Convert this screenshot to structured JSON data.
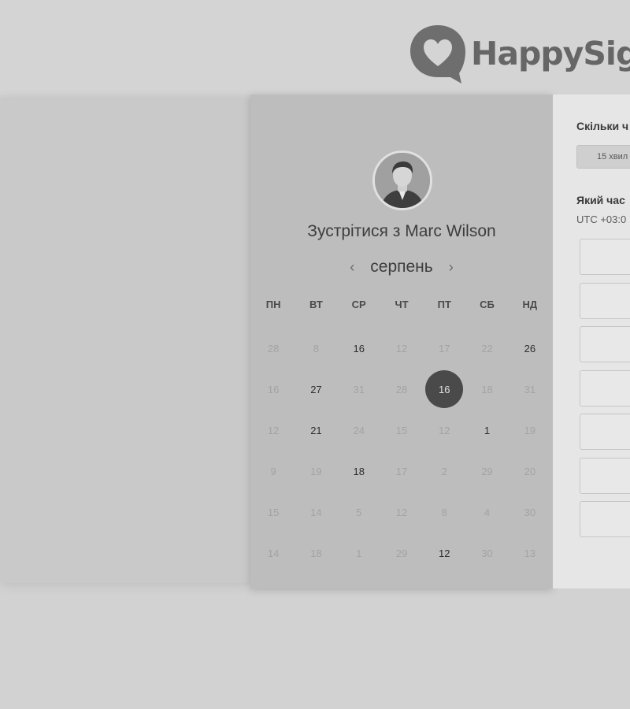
{
  "brand": {
    "name": "HappySig"
  },
  "scheduler": {
    "meet_with": "Зустрітися з Marc Wilson",
    "month": "серпень",
    "prev_arrow": "‹",
    "next_arrow": "›",
    "weekdays": [
      "ПН",
      "ВТ",
      "СР",
      "ЧТ",
      "ПТ",
      "СБ",
      "НД"
    ],
    "weeks": [
      [
        {
          "d": "28",
          "a": false
        },
        {
          "d": "8",
          "a": false
        },
        {
          "d": "16",
          "a": true
        },
        {
          "d": "12",
          "a": false
        },
        {
          "d": "17",
          "a": false
        },
        {
          "d": "22",
          "a": false
        },
        {
          "d": "26",
          "a": true
        }
      ],
      [
        {
          "d": "16",
          "a": false
        },
        {
          "d": "27",
          "a": true
        },
        {
          "d": "31",
          "a": false
        },
        {
          "d": "28",
          "a": false
        },
        {
          "d": "16",
          "a": true,
          "selected": true
        },
        {
          "d": "18",
          "a": false
        },
        {
          "d": "31",
          "a": false
        }
      ],
      [
        {
          "d": "12",
          "a": false
        },
        {
          "d": "21",
          "a": true
        },
        {
          "d": "24",
          "a": false
        },
        {
          "d": "15",
          "a": false
        },
        {
          "d": "12",
          "a": false
        },
        {
          "d": "1",
          "a": true
        },
        {
          "d": "19",
          "a": false
        }
      ],
      [
        {
          "d": "9",
          "a": false
        },
        {
          "d": "19",
          "a": false
        },
        {
          "d": "18",
          "a": true
        },
        {
          "d": "17",
          "a": false
        },
        {
          "d": "2",
          "a": false
        },
        {
          "d": "29",
          "a": false
        },
        {
          "d": "20",
          "a": false
        }
      ],
      [
        {
          "d": "15",
          "a": false
        },
        {
          "d": "14",
          "a": false
        },
        {
          "d": "5",
          "a": false
        },
        {
          "d": "12",
          "a": false
        },
        {
          "d": "8",
          "a": false
        },
        {
          "d": "4",
          "a": false
        },
        {
          "d": "30",
          "a": false
        }
      ],
      [
        {
          "d": "14",
          "a": false
        },
        {
          "d": "18",
          "a": false
        },
        {
          "d": "1",
          "a": false
        },
        {
          "d": "29",
          "a": false
        },
        {
          "d": "12",
          "a": true
        },
        {
          "d": "30",
          "a": false
        },
        {
          "d": "13",
          "a": false
        }
      ]
    ]
  },
  "right": {
    "duration_label": "Скільки ч",
    "duration_value": "15 хвил",
    "time_label": "Який час",
    "timezone": "UTC +03:0",
    "slots": [
      "",
      "",
      "",
      "",
      "",
      "",
      ""
    ]
  },
  "colors": {
    "selected_day": "#4a4a4a",
    "card_bg": "#bdbdbd"
  }
}
